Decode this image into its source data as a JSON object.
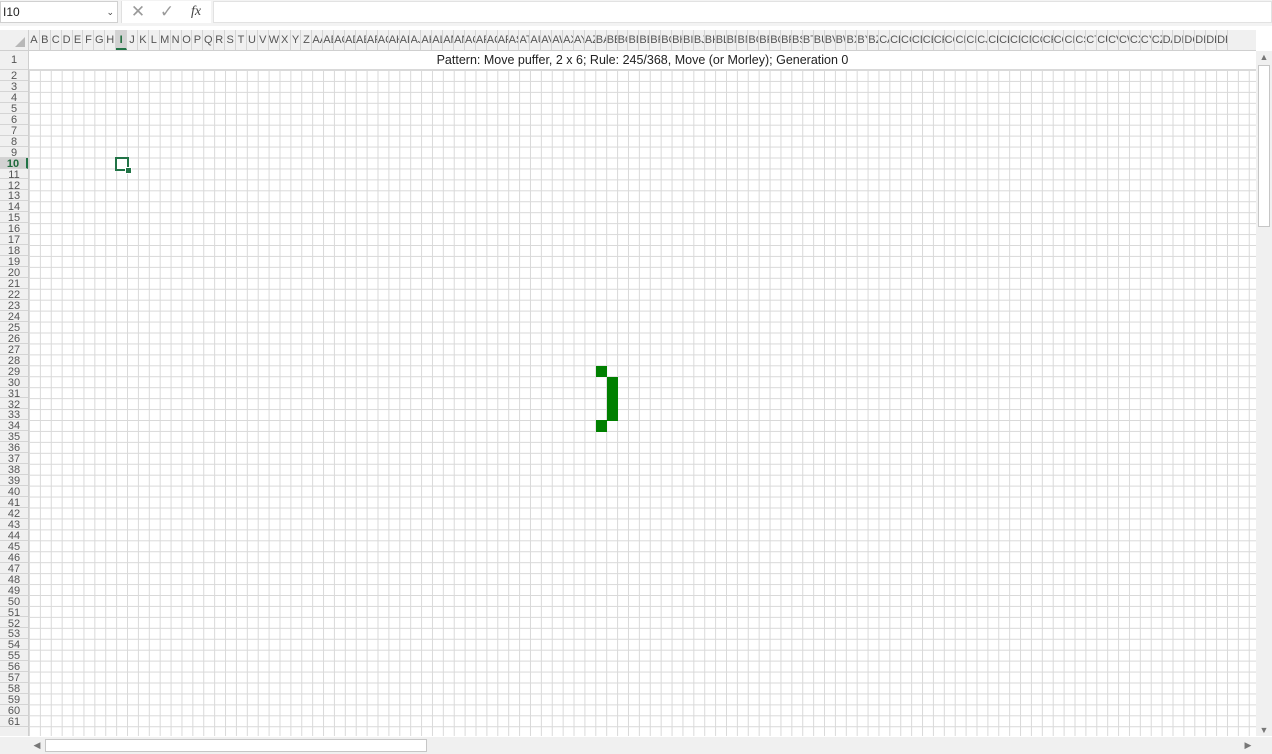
{
  "formula_bar": {
    "name_box": "I10",
    "cancel_icon": "✕",
    "enter_icon": "✓",
    "fx_label": "fx",
    "formula": ""
  },
  "columns": [
    "A",
    "B",
    "C",
    "D",
    "E",
    "F",
    "G",
    "H",
    "I",
    "J",
    "K",
    "L",
    "M",
    "N",
    "O",
    "P",
    "Q",
    "R",
    "S",
    "T",
    "U",
    "V",
    "W",
    "X",
    "Y",
    "Z",
    "AA",
    "AB",
    "AC",
    "AD",
    "AE",
    "AF",
    "AG",
    "AH",
    "AI",
    "AJ",
    "AK",
    "AL",
    "AM",
    "AN",
    "AO",
    "AP",
    "AQ",
    "AR",
    "AS",
    "AT",
    "AU",
    "AV",
    "AW",
    "AX",
    "AY",
    "AZ",
    "BA",
    "BB",
    "BC",
    "BD",
    "BE",
    "BF",
    "BG",
    "BH",
    "BI",
    "BJ",
    "BK",
    "BL",
    "BM",
    "BN",
    "BO",
    "BP",
    "BQ",
    "BR",
    "BS",
    "BT",
    "BU",
    "BV",
    "BW",
    "BX",
    "BY",
    "BZ",
    "CA",
    "CB",
    "CC",
    "CD",
    "CE",
    "CF",
    "CG",
    "CH",
    "CI",
    "CJ",
    "CK",
    "CL",
    "CM",
    "CN",
    "CO",
    "CP",
    "CQ",
    "CR",
    "CS",
    "CT",
    "CU",
    "CV",
    "CW",
    "CX",
    "CY",
    "CZ",
    "DA",
    "DB",
    "DC",
    "DD",
    "DE",
    "DF"
  ],
  "row_count": 61,
  "selected_column": "I",
  "selected_row": 10,
  "sheet": {
    "title": "Pattern: Move puffer, 2 x 6; Rule: 245/368, Move (or Morley); Generation 0"
  },
  "live_cells": [
    {
      "col": "BA",
      "row": 29
    },
    {
      "col": "BB",
      "row": 30
    },
    {
      "col": "BB",
      "row": 31
    },
    {
      "col": "BB",
      "row": 32
    },
    {
      "col": "BB",
      "row": 33
    },
    {
      "col": "BA",
      "row": 34
    }
  ],
  "colors": {
    "live": "#008000",
    "selection": "#217346"
  }
}
